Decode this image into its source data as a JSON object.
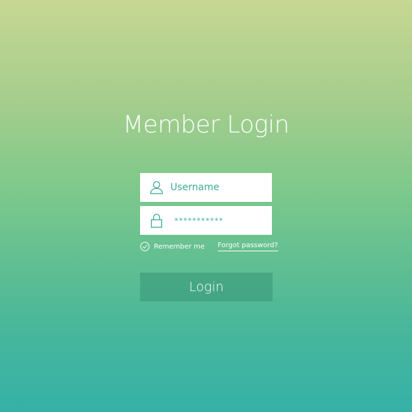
{
  "page": {
    "title": "Member Login"
  },
  "form": {
    "username": {
      "placeholder": "Username",
      "value": "",
      "icon": "user-icon"
    },
    "password": {
      "value": "***********",
      "icon": "lock-icon"
    },
    "remember_label": "Remember me",
    "remember_checked": true,
    "forgot_label": "Forgot password?",
    "submit_label": "Login"
  },
  "colors": {
    "accent": "#3aab96",
    "text_light": "#ffffff",
    "button_bg": "#4da284"
  }
}
